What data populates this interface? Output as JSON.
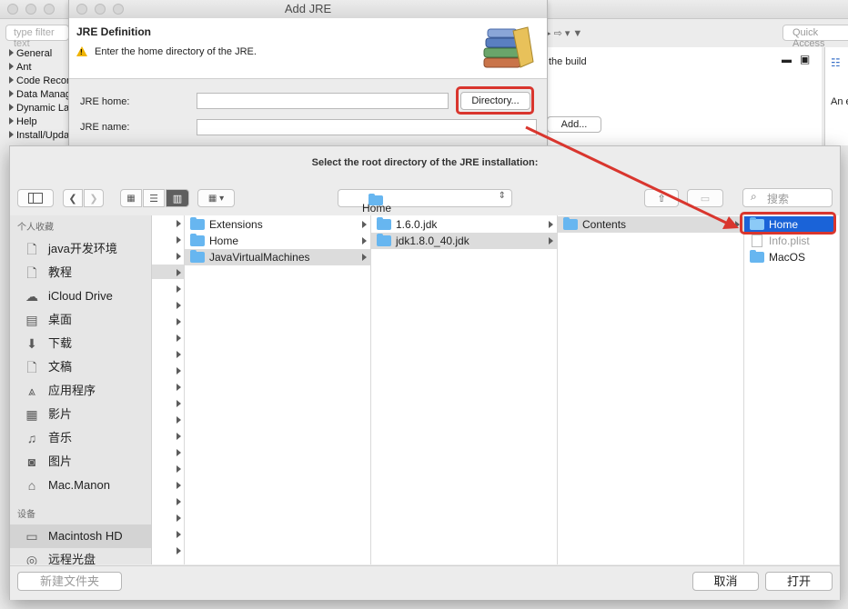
{
  "background_app": {
    "filter_placeholder": "type filter text",
    "quick_access": "Quick Access",
    "tree_items": [
      "General",
      "Ant",
      "Code Recommenders",
      "Data Management",
      "Dynamic Languages",
      "Help",
      "Install/Update"
    ],
    "the_build_text": "the build",
    "add_button": "Add...",
    "an_text": "An e"
  },
  "jre_dialog": {
    "title": "Add JRE",
    "definition_title": "JRE Definition",
    "description": "Enter the home directory of the JRE.",
    "jre_home_label": "JRE home:",
    "jre_home_value": "",
    "jre_name_label": "JRE name:",
    "jre_name_value": "",
    "directory_button": "Directory..."
  },
  "file_chooser": {
    "title": "Select the root directory of the JRE installation:",
    "location": "Home",
    "search_placeholder": "搜索",
    "sidebar": {
      "favorites_header": "个人收藏",
      "favorites": [
        {
          "label": "java开发环境",
          "icon": "document-icon"
        },
        {
          "label": "教程",
          "icon": "document-icon"
        },
        {
          "label": "iCloud Drive",
          "icon": "cloud-icon"
        },
        {
          "label": "桌面",
          "icon": "desktop-icon"
        },
        {
          "label": "下载",
          "icon": "download-icon"
        },
        {
          "label": "文稿",
          "icon": "document-icon"
        },
        {
          "label": "应用程序",
          "icon": "applications-icon"
        },
        {
          "label": "影片",
          "icon": "film-icon"
        },
        {
          "label": "音乐",
          "icon": "music-icon"
        },
        {
          "label": "图片",
          "icon": "camera-icon"
        },
        {
          "label": "Mac.Manon",
          "icon": "home-icon"
        }
      ],
      "devices_header": "设备",
      "devices": [
        {
          "label": "Macintosh HD",
          "icon": "disk-icon"
        },
        {
          "label": "远程光盘",
          "icon": "remote-disc-icon"
        }
      ]
    },
    "column1": [
      "Extensions",
      "Home",
      "JavaVirtualMachines"
    ],
    "column2": [
      "1.6.0.jdk",
      "jdk1.8.0_40.jdk"
    ],
    "column3": [
      "Contents"
    ],
    "column4": [
      "Home",
      "Info.plist",
      "MacOS"
    ],
    "new_folder_button": "新建文件夹",
    "cancel_button": "取消",
    "open_button": "打开"
  },
  "colors": {
    "annotation_red": "#d9362e",
    "selection_blue": "#1a63d8",
    "folder_blue": "#67b6f0"
  }
}
